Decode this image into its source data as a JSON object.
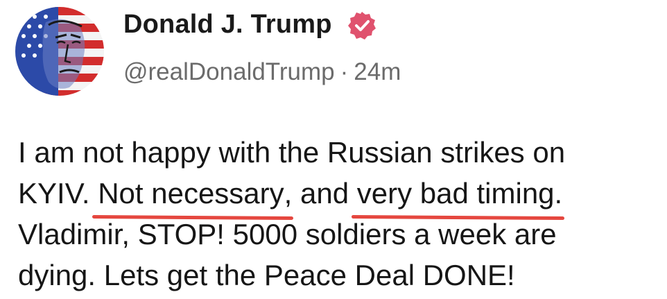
{
  "author": {
    "name": "Donald J. Trump",
    "handle": "@realDonaldTrump",
    "separator": "·",
    "timestamp": "24m",
    "verified": true,
    "avatar_icon": "flag-portrait-avatar",
    "verified_icon": "verified-badge-icon",
    "verified_color": "#e0526e"
  },
  "post": {
    "line1": "I am not happy with the Russian strikes on",
    "line2_a": "KYIV. ",
    "line2_highlight1": "Not necessary",
    "line2_b": ", and ",
    "line2_highlight2": "very bad timing",
    "line2_c": ".",
    "line3": "Vladimir, STOP! 5000 soldiers a week are",
    "line4": "dying. Lets get the Peace Deal DONE!",
    "underline_color": "#e5473f"
  }
}
